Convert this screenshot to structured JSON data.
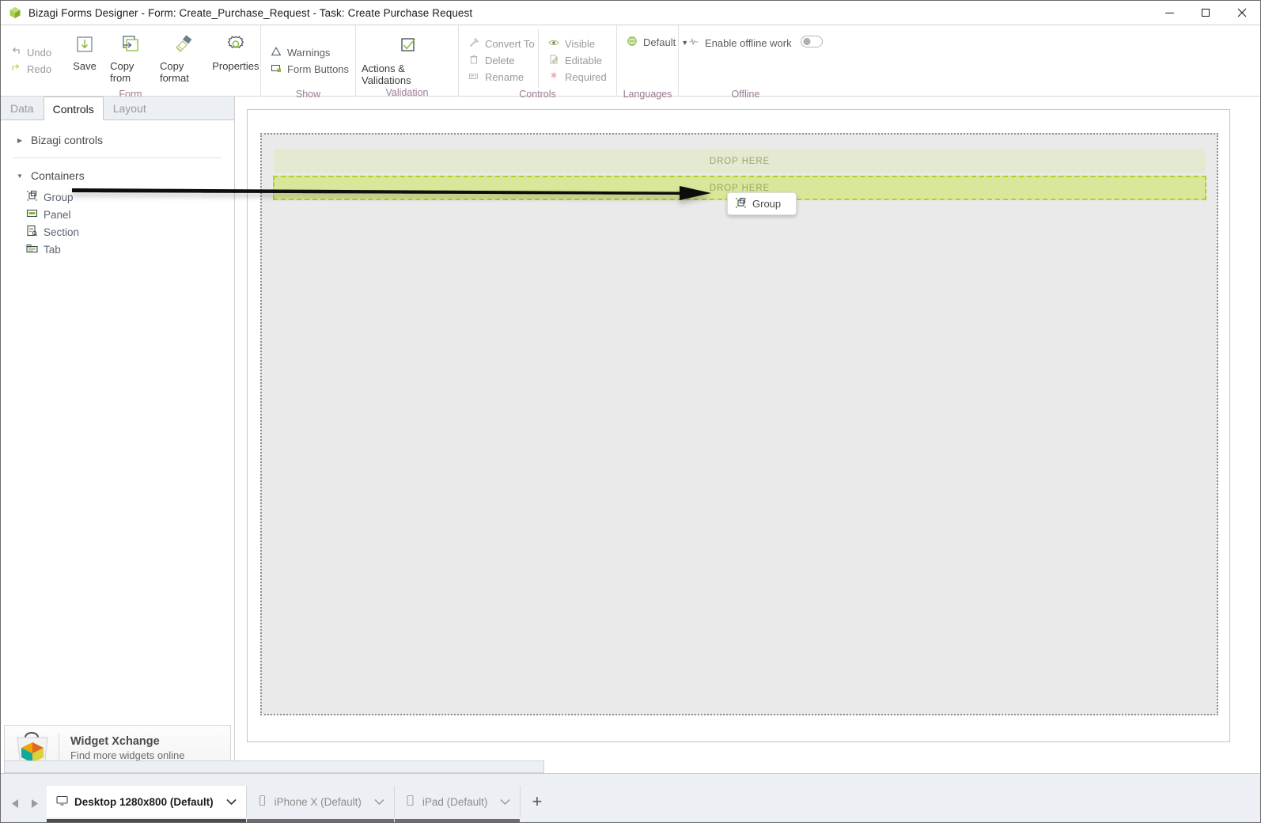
{
  "window": {
    "title": "Bizagi Forms Designer  - Form: Create_Purchase_Request - Task:  Create Purchase Request",
    "app_icon": "bizagi-cube-icon",
    "minimize_label": "—",
    "maximize_label": "□",
    "close_label": "✕"
  },
  "ribbon": {
    "groups": [
      {
        "name": "form",
        "label": "Form",
        "small_items": [
          {
            "label": "Undo",
            "icon": "undo-icon",
            "dim": true
          },
          {
            "label": "Redo",
            "icon": "redo-icon",
            "dim": true
          }
        ],
        "big_items": [
          {
            "label": "Save",
            "icon": "save-icon"
          },
          {
            "label": "Copy from",
            "icon": "copy-from-icon"
          },
          {
            "label": "Copy format",
            "icon": "copy-format-icon"
          },
          {
            "label": "Properties",
            "icon": "properties-gear-icon"
          }
        ]
      },
      {
        "name": "show",
        "label": "Show",
        "small_items": [
          {
            "label": "Warnings",
            "icon": "warning-triangle-icon",
            "dim": false
          },
          {
            "label": "Form Buttons",
            "icon": "form-buttons-icon",
            "dim": false
          }
        ]
      },
      {
        "name": "validation",
        "label": "Validation",
        "big_items": [
          {
            "label": "Actions & Validations",
            "icon": "checkmark-box-icon"
          }
        ]
      },
      {
        "name": "controls",
        "label": "Controls",
        "small_items": [
          {
            "label": "Convert To",
            "icon": "convert-to-icon",
            "dim": true
          },
          {
            "label": "Delete",
            "icon": "trash-icon",
            "dim": true
          },
          {
            "label": "Rename",
            "icon": "rename-icon",
            "dim": true
          },
          {
            "label": "Visible",
            "icon": "eye-icon",
            "dim": true
          },
          {
            "label": "Editable",
            "icon": "editable-pencil-icon",
            "dim": true
          },
          {
            "label": "Required",
            "icon": "required-asterisk-icon",
            "dim": true
          }
        ]
      },
      {
        "name": "languages",
        "label": "Languages",
        "small_items": [
          {
            "label": "Default",
            "icon": "globe-icon",
            "dim": false,
            "has_dropdown": true
          }
        ]
      },
      {
        "name": "offline",
        "label": "Offline",
        "small_items": [
          {
            "label": "Enable offline work",
            "icon": "offline-icon",
            "dim": false,
            "toggle": "off"
          }
        ]
      }
    ]
  },
  "sidebar": {
    "tabs": [
      {
        "label": "Data",
        "active": false
      },
      {
        "label": "Controls",
        "active": true
      },
      {
        "label": "Layout",
        "active": false
      }
    ],
    "groups": [
      {
        "label": "Bizagi controls",
        "expanded": false,
        "caret": "▶",
        "items": []
      },
      {
        "label": "Containers",
        "expanded": true,
        "caret": "▼",
        "items": [
          {
            "label": "Group",
            "icon": "group-control-icon"
          },
          {
            "label": "Panel",
            "icon": "panel-control-icon"
          },
          {
            "label": "Section",
            "icon": "section-control-icon"
          },
          {
            "label": "Tab",
            "icon": "tab-control-icon"
          }
        ]
      }
    ],
    "widget_xchange": {
      "title": "Widget Xchange",
      "subtitle": "Find more widgets online",
      "icon": "shopping-bag-icon"
    }
  },
  "canvas": {
    "dropzones": [
      {
        "label": "DROP HERE",
        "state": "idle"
      },
      {
        "label": "DROP HERE",
        "state": "active"
      }
    ],
    "drag_ghost": {
      "label": "Group",
      "icon": "group-control-icon"
    },
    "annotation_arrow": "drag-arrow-from-group-to-dropzone"
  },
  "bottombar": {
    "prev_label": "◀",
    "next_label": "▶",
    "add_label": "+",
    "devices": [
      {
        "label": "Desktop 1280x800 (Default)",
        "icon": "monitor-icon",
        "active": true,
        "chevron": "⌄"
      },
      {
        "label": "iPhone X (Default)",
        "icon": "phone-icon",
        "active": false,
        "chevron": "⌄"
      },
      {
        "label": "iPad (Default)",
        "icon": "tablet-icon",
        "active": false,
        "chevron": "⌄"
      }
    ]
  },
  "colors": {
    "accent_green": "#b2cf2a",
    "dropzone_idle": "#e4ead1",
    "dropzone_active": "#d9e79a",
    "group_label": "#9e7b93"
  }
}
